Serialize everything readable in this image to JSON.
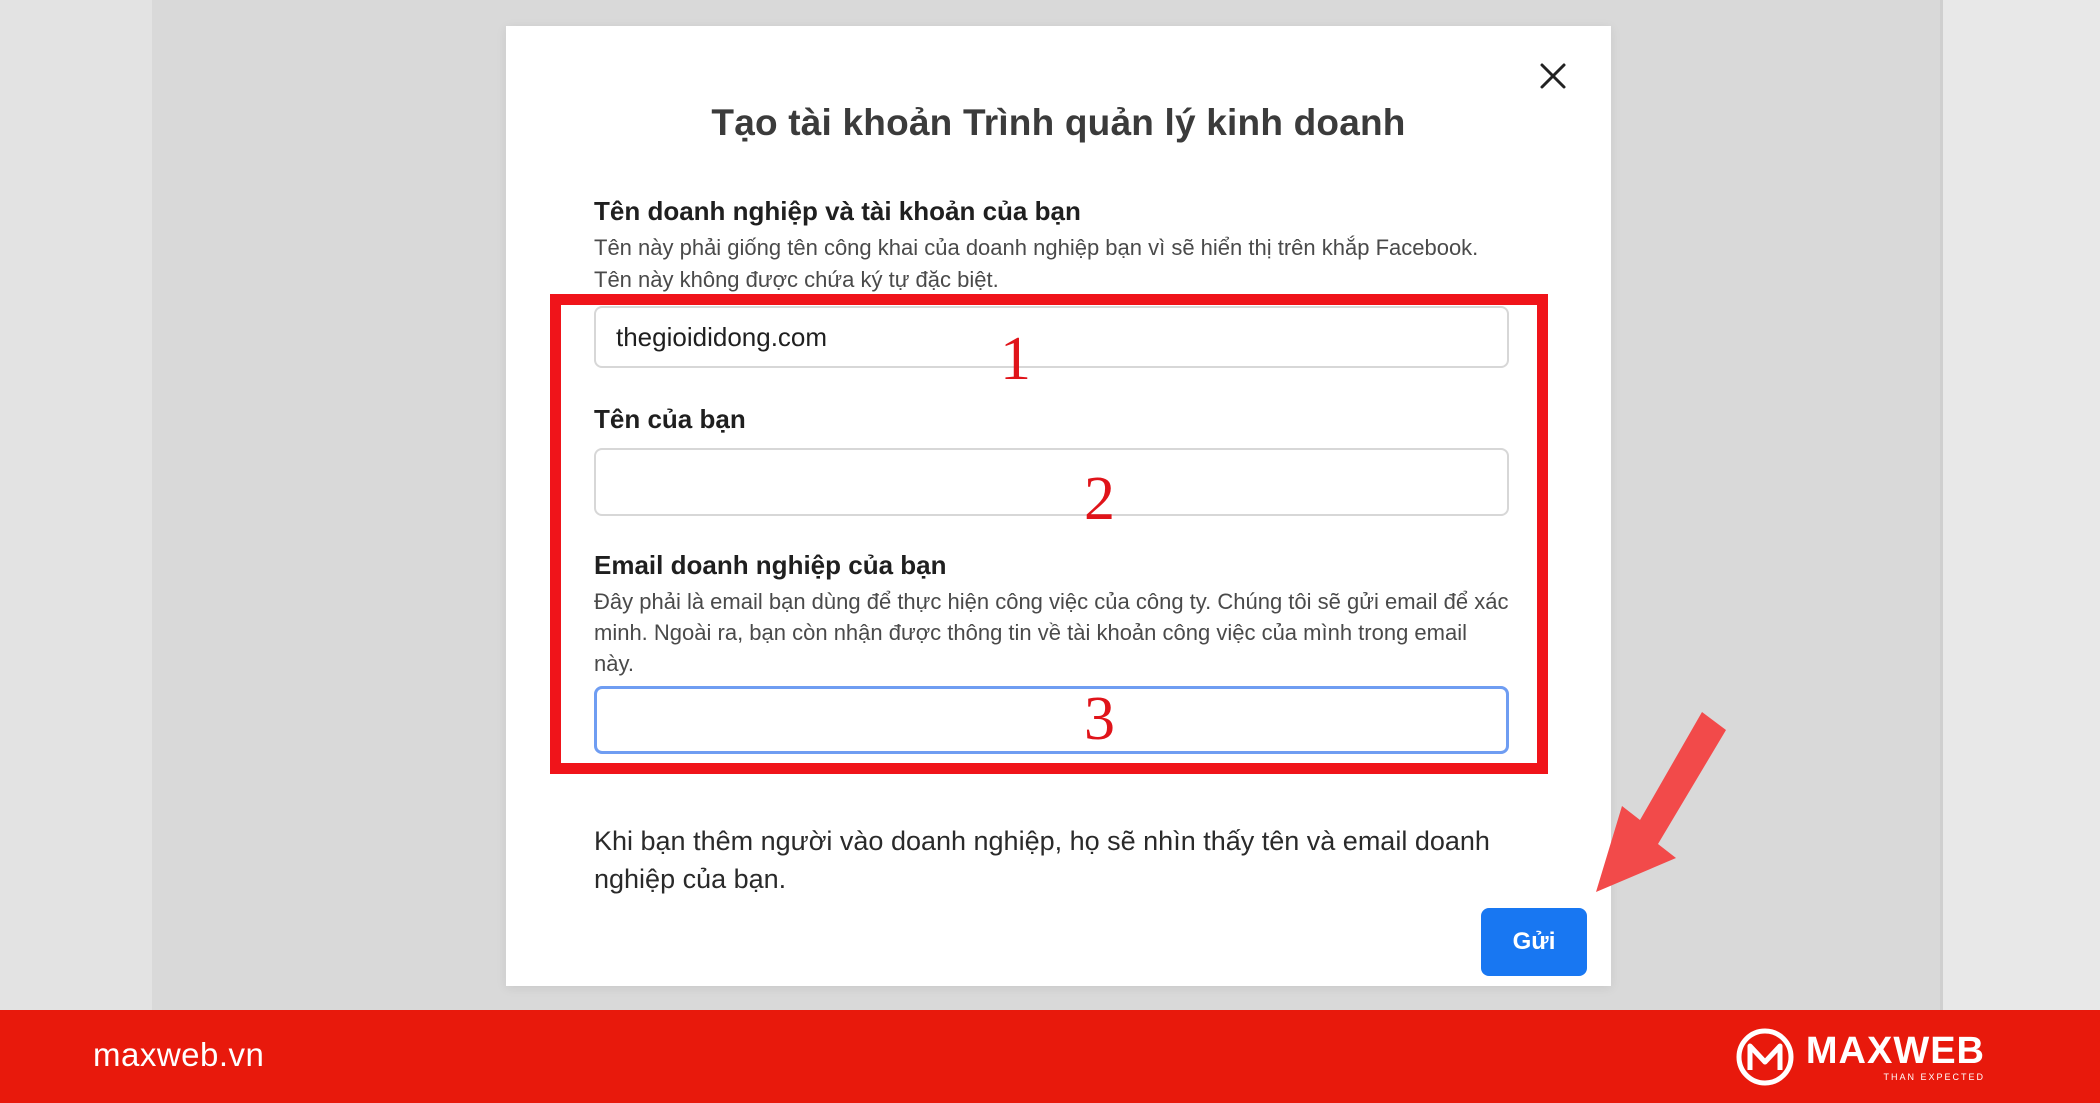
{
  "modal": {
    "title": "Tạo tài khoản Trình quản lý kinh doanh",
    "close_icon": "close-icon"
  },
  "business_section": {
    "label": "Tên doanh nghiệp và tài khoản của bạn",
    "help_line1": "Tên này phải giống tên công khai của doanh nghiệp bạn vì sẽ hiển thị trên khắp Facebook.",
    "help_line2": "Tên này không được chứa ký tự đặc biệt.",
    "value": "thegioididong.com",
    "placeholder": ""
  },
  "name_section": {
    "label": "Tên của bạn",
    "value": "",
    "placeholder": ""
  },
  "email_section": {
    "label": "Email doanh nghiệp của bạn",
    "help": "Đây phải là email bạn dùng để thực hiện công việc của công ty. Chúng tôi sẽ gửi email để xác minh. Ngoài ra, bạn còn nhận được thông tin về tài khoản công việc của mình trong email này.",
    "value": "",
    "placeholder": ""
  },
  "footnote": "Khi bạn thêm người vào doanh nghiệp, họ sẽ nhìn thấy tên và email doanh nghiệp của bạn.",
  "submit_label": "Gửi",
  "annotations": {
    "step1": "1",
    "step2": "2",
    "step3": "3",
    "highlight_color": "#f0141a",
    "arrow_color": "#f24a4a"
  },
  "footer": {
    "site": "maxweb.vn",
    "brand_name": "MAXWEB",
    "brand_tagline": "THAN EXPECTED",
    "bar_color": "#e8190c"
  },
  "colors": {
    "primary_button": "#1877f2",
    "focus_border": "#6f9df2"
  }
}
